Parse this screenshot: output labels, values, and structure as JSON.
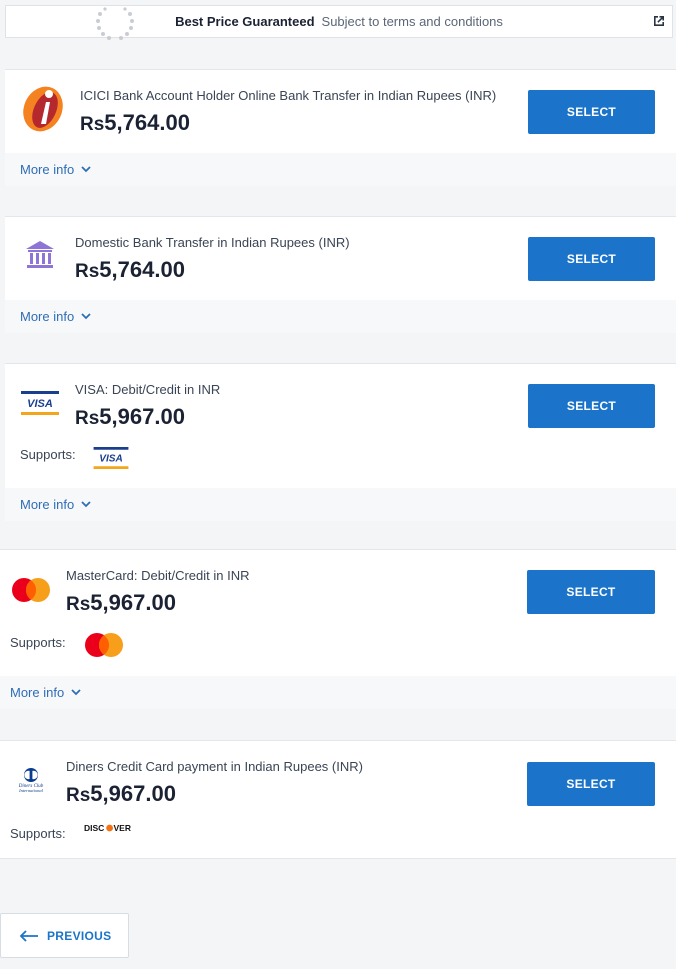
{
  "banner": {
    "title": "Best Price Guaranteed",
    "subtitle": "Subject to terms and conditions"
  },
  "payment_options": [
    {
      "name": "ICICI Bank Account Holder Online Bank Transfer in Indian Rupees (INR)",
      "currency": "Rs",
      "amount": "5,764.00",
      "select_label": "SELECT",
      "more_info_label": "More info"
    },
    {
      "name": "Domestic Bank Transfer in Indian Rupees (INR)",
      "currency": "Rs",
      "amount": "5,764.00",
      "select_label": "SELECT",
      "more_info_label": "More info"
    },
    {
      "name": "VISA: Debit/Credit in INR",
      "currency": "Rs",
      "amount": "5,967.00",
      "select_label": "SELECT",
      "supports_label": "Supports:",
      "logo_text": "VISA",
      "more_info_label": "More info"
    },
    {
      "name": "MasterCard: Debit/Credit in INR",
      "currency": "Rs",
      "amount": "5,967.00",
      "select_label": "SELECT",
      "supports_label": "Supports:",
      "more_info_label": "More info"
    },
    {
      "name": "Diners Credit Card payment in Indian Rupees (INR)",
      "currency": "Rs",
      "amount": "5,967.00",
      "select_label": "SELECT",
      "supports_label": "Supports:",
      "diners_logo_line1": "Diners Club",
      "diners_logo_line2": "International",
      "discover_text_a": "DISC",
      "discover_text_b": "VER"
    }
  ],
  "navigation": {
    "previous_label": "PREVIOUS"
  },
  "colors": {
    "primary": "#1b74c9",
    "link": "#2f6db5",
    "background": "#f4f5f7"
  }
}
